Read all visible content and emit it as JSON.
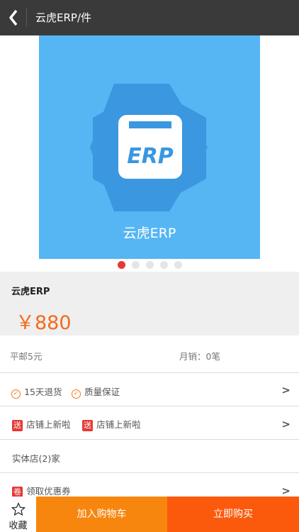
{
  "header": {
    "back_icon": "chevron-left-icon",
    "title": "云虎ERP/件"
  },
  "banner": {
    "background_color": "#55b6f3",
    "logo_text": "ERP",
    "caption": "云虎ERP",
    "dots_total": 5,
    "active_dot": 1
  },
  "product": {
    "name": "云虎ERP",
    "price": "￥880",
    "price_color": "#f26b1d"
  },
  "shipping": {
    "postage": "平邮5元",
    "monthly_sales": "月销：0笔"
  },
  "guarantee": {
    "items": [
      "15天退货",
      "质量保证"
    ],
    "chevron": ">"
  },
  "promos": {
    "badge": "送",
    "items": [
      "店铺上新啦",
      "店铺上新啦"
    ],
    "chevron": ">"
  },
  "stores": {
    "label": "实体店(2)家"
  },
  "coupon": {
    "badge": "卷",
    "label": "领取优惠券",
    "chevron": ">"
  },
  "footer": {
    "favorite_icon": "star-outline-icon",
    "favorite_label": "收藏",
    "cart_label": "加入购物车",
    "buy_label": "立即购买",
    "cart_color": "#f7860e",
    "buy_color": "#fb5a0d"
  }
}
